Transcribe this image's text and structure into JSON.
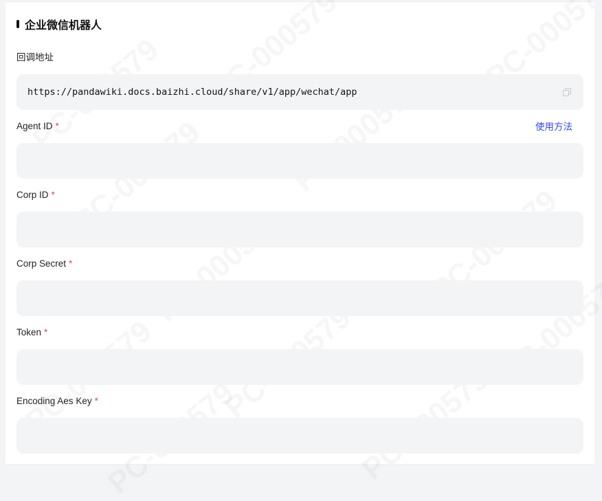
{
  "section": {
    "title": "企业微信机器人"
  },
  "callback": {
    "label": "回调地址",
    "url": "https://pandawiki.docs.baizhi.cloud/share/v1/app/wechat/app"
  },
  "help_link": "使用方法",
  "required_mark": "*",
  "fields": [
    {
      "label": "Agent ID",
      "value": ""
    },
    {
      "label": "Corp ID",
      "value": ""
    },
    {
      "label": "Corp Secret",
      "value": ""
    },
    {
      "label": "Token",
      "value": ""
    },
    {
      "label": "Encoding Aes Key",
      "value": ""
    }
  ],
  "watermark": "PC-000579",
  "icons": {
    "copy": "copy-icon"
  },
  "colors": {
    "accent": "#3248f2",
    "required": "#e5484d",
    "field_bg": "#f3f4f6"
  }
}
